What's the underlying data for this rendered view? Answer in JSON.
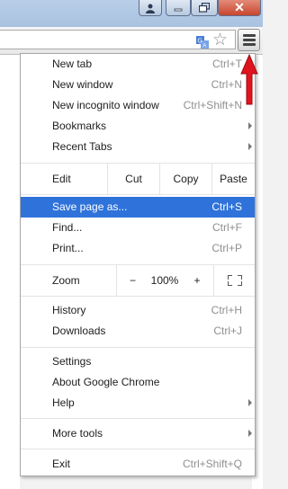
{
  "window": {
    "close_glyph": "✕"
  },
  "toolbar": {
    "star_icon": "☆",
    "menu_icon": "hamburger-menu-icon"
  },
  "menu": {
    "items": [
      {
        "label": "New tab",
        "shortcut": "Ctrl+T"
      },
      {
        "label": "New window",
        "shortcut": "Ctrl+N"
      },
      {
        "label": "New incognito window",
        "shortcut": "Ctrl+Shift+N"
      },
      {
        "label": "Bookmarks"
      },
      {
        "label": "Recent Tabs"
      }
    ],
    "edit": {
      "label": "Edit",
      "cut": "Cut",
      "copy": "Copy",
      "paste": "Paste"
    },
    "save": {
      "label": "Save page as...",
      "shortcut": "Ctrl+S"
    },
    "find": {
      "label": "Find...",
      "shortcut": "Ctrl+F"
    },
    "print": {
      "label": "Print...",
      "shortcut": "Ctrl+P"
    },
    "zoom": {
      "label": "Zoom",
      "minus": "−",
      "value": "100%",
      "plus": "+"
    },
    "history": {
      "label": "History",
      "shortcut": "Ctrl+H"
    },
    "downloads": {
      "label": "Downloads",
      "shortcut": "Ctrl+J"
    },
    "settings": {
      "label": "Settings"
    },
    "about": {
      "label": "About Google Chrome"
    },
    "help": {
      "label": "Help"
    },
    "more_tools": {
      "label": "More tools"
    },
    "exit": {
      "label": "Exit",
      "shortcut": "Ctrl+Shift+Q"
    }
  },
  "colors": {
    "highlight": "#2f73da",
    "annotation_arrow": "#e0141e"
  }
}
